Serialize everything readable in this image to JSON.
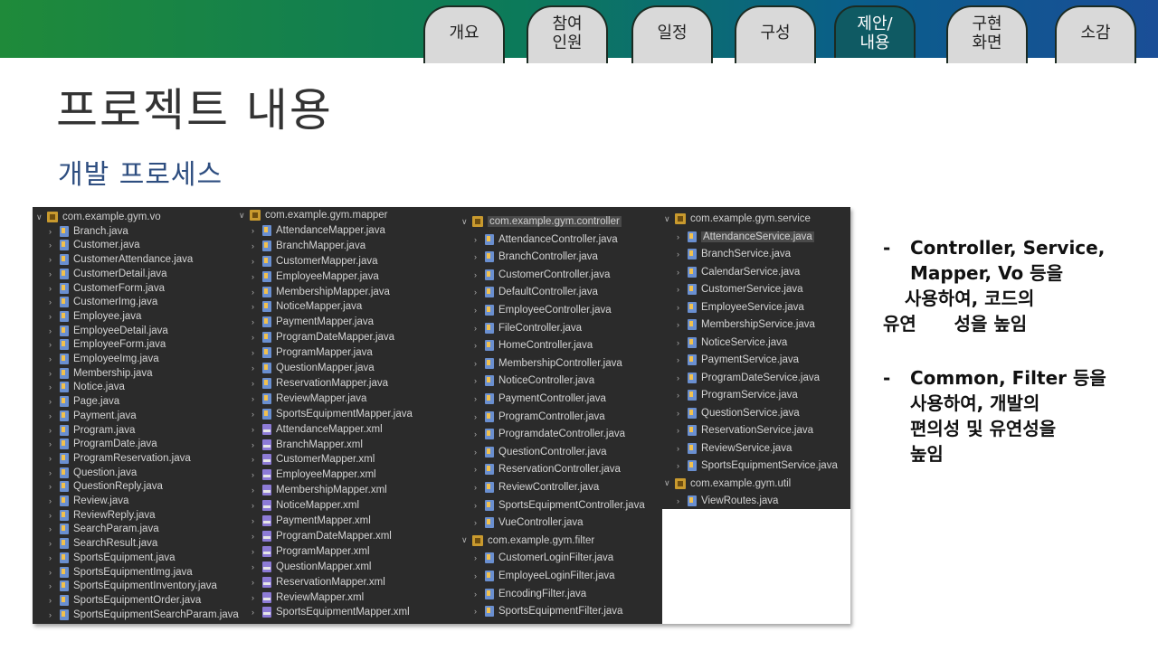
{
  "header": {
    "tabs": [
      {
        "label": "개요",
        "active": false
      },
      {
        "label": "참여\n인원",
        "active": false
      },
      {
        "label": "일정",
        "active": false
      },
      {
        "label": "구성",
        "active": false
      },
      {
        "label": "제안/\n내용",
        "active": true
      },
      {
        "label": "구현\n화면",
        "active": false
      },
      {
        "label": "소감",
        "active": false
      }
    ],
    "gradient_colors": [
      "#1f8a3a",
      "#1a4e97"
    ]
  },
  "title": "프로젝트 내용",
  "subtitle": "개발 프로세스",
  "explorer": {
    "columns": [
      {
        "package": "com.example.gym.vo",
        "files": [
          "Branch.java",
          "Customer.java",
          "CustomerAttendance.java",
          "CustomerDetail.java",
          "CustomerForm.java",
          "CustomerImg.java",
          "Employee.java",
          "EmployeeDetail.java",
          "EmployeeForm.java",
          "EmployeeImg.java",
          "Membership.java",
          "Notice.java",
          "Page.java",
          "Payment.java",
          "Program.java",
          "ProgramDate.java",
          "ProgramReservation.java",
          "Question.java",
          "QuestionReply.java",
          "Review.java",
          "ReviewReply.java",
          "SearchParam.java",
          "SearchResult.java",
          "SportsEquipment.java",
          "SportsEquipmentImg.java",
          "SportsEquipmentInventory.java",
          "SportsEquipmentOrder.java",
          "SportsEquipmentSearchParam.java"
        ]
      },
      {
        "package": "com.example.gym.mapper",
        "files": [
          "AttendanceMapper.java",
          "BranchMapper.java",
          "CustomerMapper.java",
          "EmployeeMapper.java",
          "MembershipMapper.java",
          "NoticeMapper.java",
          "PaymentMapper.java",
          "ProgramDateMapper.java",
          "ProgramMapper.java",
          "QuestionMapper.java",
          "ReservationMapper.java",
          "ReviewMapper.java",
          "SportsEquipmentMapper.java",
          "AttendanceMapper.xml",
          "BranchMapper.xml",
          "CustomerMapper.xml",
          "EmployeeMapper.xml",
          "MembershipMapper.xml",
          "NoticeMapper.xml",
          "PaymentMapper.xml",
          "ProgramDateMapper.xml",
          "ProgramMapper.xml",
          "QuestionMapper.xml",
          "ReservationMapper.xml",
          "ReviewMapper.xml",
          "SportsEquipmentMapper.xml"
        ]
      },
      {
        "package": "com.example.gym.controller",
        "files": [
          "AttendanceController.java",
          "BranchController.java",
          "CustomerController.java",
          "DefaultController.java",
          "EmployeeController.java",
          "FileController.java",
          "HomeController.java",
          "MembershipController.java",
          "NoticeController.java",
          "PaymentController.java",
          "ProgramController.java",
          "ProgramdateController.java",
          "QuestionController.java",
          "ReservationController.java",
          "ReviewController.java",
          "SportsEquipmentController.java",
          "VueController.java"
        ],
        "package2": "com.example.gym.filter",
        "files2": [
          "CustomerLoginFilter.java",
          "EmployeeLoginFilter.java",
          "EncodingFilter.java",
          "SportsEquipmentFilter.java"
        ]
      },
      {
        "package": "com.example.gym.service",
        "files": [
          "AttendanceService.java",
          "BranchService.java",
          "CalendarService.java",
          "CustomerService.java",
          "EmployeeService.java",
          "MembershipService.java",
          "NoticeService.java",
          "PaymentService.java",
          "ProgramDateService.java",
          "ProgramService.java",
          "QuestionService.java",
          "ReservationService.java",
          "ReviewService.java",
          "SportsEquipmentService.java"
        ],
        "package2": "com.example.gym.util",
        "files2": [
          "ViewRoutes.java"
        ]
      }
    ]
  },
  "bullets": {
    "b1": {
      "dash": "-",
      "line1": "Controller, Service,",
      "line2": "Mapper, Vo 등을",
      "line3": "사용하여, 코드의",
      "line4": "유연      성을 높임"
    },
    "b2": {
      "dash": "-",
      "line1": "Common, Filter 등을",
      "line2": "사용하여, 개발의",
      "line3": "편의성 및 유연성을",
      "line4": "높임"
    }
  }
}
